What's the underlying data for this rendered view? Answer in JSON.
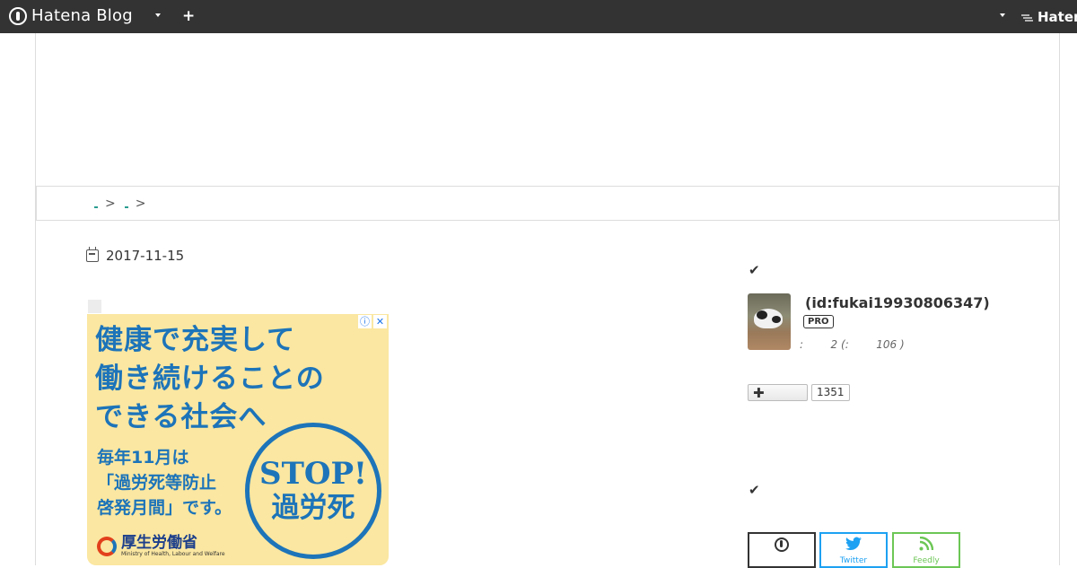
{
  "topbar": {
    "logo_text": "Hatena Blog",
    "plus_label": "+",
    "right_brand_text": "Haten"
  },
  "breadcrumb": {
    "separators": [
      ">",
      ">"
    ]
  },
  "article": {
    "date": "2017-11-15"
  },
  "ad": {
    "info_label": "ⓘ",
    "close_label": "✕",
    "headline_lines": [
      "健康で充実して",
      "働き続けることの",
      "できる社会へ"
    ],
    "sub_lines": [
      "毎年11月は",
      "「過労死等防止",
      "啓発月間」です。"
    ],
    "stamp_top": "STOP!",
    "stamp_bottom": "過労死",
    "ministry_name": "厚生労働省",
    "ministry_en": "Ministry of Health, Labour and Welfare"
  },
  "sidebar": {
    "check_glyph": "✔",
    "profile": {
      "id_text": "(id:fukai19930806347)",
      "badge": "PRO",
      "stats_text": ":        2 (:        106 )"
    },
    "follow": {
      "button_glyph": "✚",
      "count": "1351"
    },
    "subscribe": {
      "twitter_label": "Twitter",
      "feedly_label": "Feedly"
    }
  },
  "colors": {
    "topbar_bg": "#333333",
    "ad_bg": "#fbe7a1",
    "ad_text": "#1d74b9",
    "twitter": "#1da1f2",
    "feedly": "#6cc655"
  }
}
